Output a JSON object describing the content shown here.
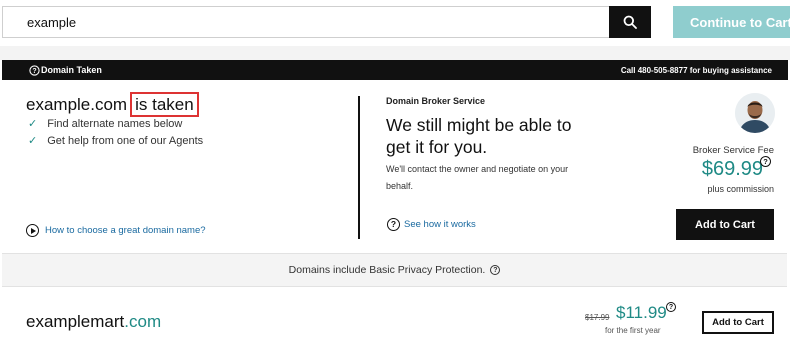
{
  "search": {
    "value": "example",
    "continue_label": "Continue to Cart"
  },
  "header_bar": {
    "status": "Domain Taken",
    "phone_text": "Call 480-505-8877 for buying assistance"
  },
  "taken": {
    "domain": "example.com",
    "status_text": "is taken",
    "items": [
      "Find alternate names below",
      "Get help from one of our Agents"
    ],
    "link": "How to choose a great domain name?"
  },
  "broker": {
    "eyebrow": "Domain Broker Service",
    "headline": "We still might be able to get it for you.",
    "description": "We'll contact the owner and negotiate on your behalf.",
    "link": "See how it works",
    "fee_label": "Broker Service Fee",
    "fee_price": "$69.99",
    "fee_sub": "plus commission",
    "cta": "Add to Cart"
  },
  "privacy": {
    "text": "Domains include Basic Privacy Protection."
  },
  "result": {
    "name": "examplemart",
    "tld": ".com",
    "old_price": "$17.99",
    "price": "$11.99",
    "term": "for the first year",
    "cta": "Add to Cart"
  },
  "colors": {
    "accent": "#1f8a85",
    "continue_bg": "#8fcdce",
    "dark": "#111111",
    "highlight": "#dd3333"
  }
}
